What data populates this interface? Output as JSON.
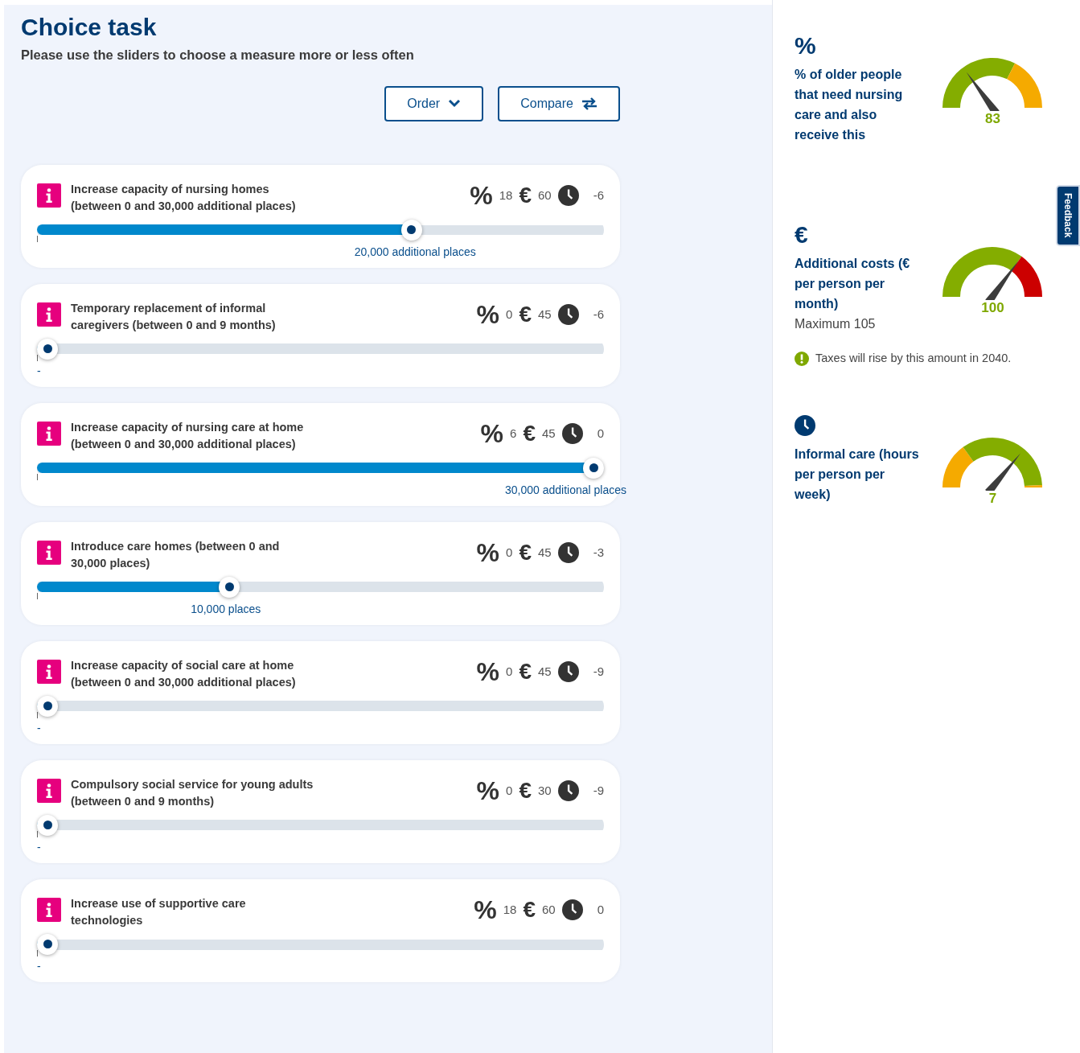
{
  "title": "Choice task",
  "subtitle": "Please use the sliders to choose a measure more or less often",
  "buttons": [
    {
      "label": "Order",
      "kind": "dropdown"
    },
    {
      "label": "Compare",
      "kind": "swap"
    }
  ],
  "measures": [
    {
      "title": "Increase capacity of nursing homes\n(between 0 and 30,000 additional places)",
      "percent_symbol": "%",
      "percent": "18",
      "euro_symbol": "€",
      "cost": "60",
      "hours": "-6",
      "level": 0.667,
      "value_label": "20,000 additional places"
    },
    {
      "title": "Temporary replacement of informal\ncaregivers (between 0 and 9 months)",
      "percent_symbol": "%",
      "percent": "0",
      "euro_symbol": "€",
      "cost": "45",
      "hours": "-6",
      "level": 0,
      "value_label": "-"
    },
    {
      "title": "Increase capacity of nursing care at home\n(between 0 and 30,000 additional places)",
      "percent_symbol": "%",
      "percent": "6",
      "euro_symbol": "€",
      "cost": "45",
      "hours": "0",
      "level": 1,
      "value_label": "30,000 additional places"
    },
    {
      "title": "Introduce care homes (between 0 and\n30,000 places)",
      "percent_symbol": "%",
      "percent": "0",
      "euro_symbol": "€",
      "cost": "45",
      "hours": "-3",
      "level": 0.333,
      "value_label": "10,000 places"
    },
    {
      "title": "Increase capacity of social care at home\n(between 0 and 30,000 additional places)",
      "percent_symbol": "%",
      "percent": "0",
      "euro_symbol": "€",
      "cost": "45",
      "hours": "-9",
      "level": 0,
      "value_label": "-"
    },
    {
      "title": "Compulsory social service for young adults\n(between 0 and 9 months)",
      "percent_symbol": "%",
      "percent": "0",
      "euro_symbol": "€",
      "cost": "30",
      "hours": "-9",
      "level": 0,
      "value_label": "-"
    },
    {
      "title": "Increase use of supportive care\ntechnologies",
      "percent_symbol": "%",
      "percent": "18",
      "euro_symbol": "€",
      "cost": "60",
      "hours": "0",
      "level": 0,
      "value_label": "-"
    }
  ],
  "indicators": [
    {
      "kind": "symbol",
      "symbol": "%",
      "label": "% of older people that need nursing care and also receive this",
      "value": "83",
      "segments": [
        {
          "color": "#84ad00"
        },
        {
          "color": "#f5aa00"
        }
      ]
    },
    {
      "kind": "symbol",
      "symbol": "€",
      "label": "Additional costs (€ per person per month)",
      "note": "Maximum  105",
      "warning": "Taxes will rise by this amount in 2040.",
      "value": "100",
      "segments": [
        {
          "color": "#84ad00"
        },
        {
          "color": "#cc0000"
        }
      ]
    },
    {
      "kind": "clock",
      "label": "Informal care (hours per person per week)",
      "value": "7",
      "segments": [
        {
          "color": "#f5aa00"
        },
        {
          "color": "#84ad00"
        },
        {
          "color": "#f5aa00"
        }
      ]
    }
  ],
  "feedback_tab": "Feedback"
}
